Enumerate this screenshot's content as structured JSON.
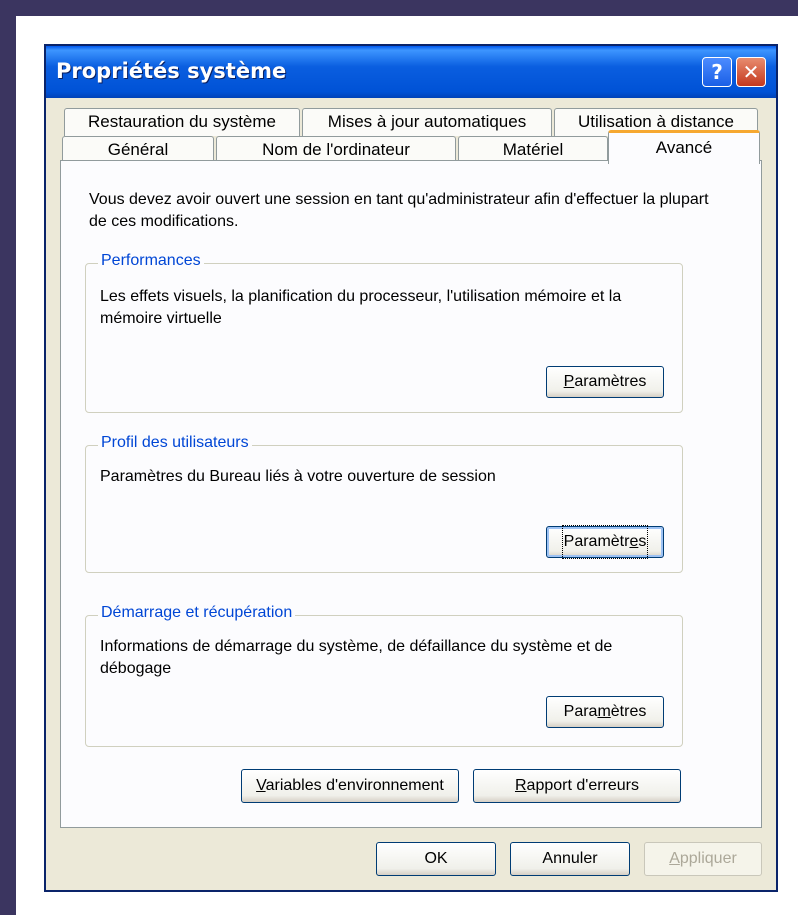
{
  "window": {
    "title": "Propriétés système",
    "help_label": "?",
    "close_label": "✕"
  },
  "tabs": {
    "row1": [
      "Restauration du système",
      "Mises à jour automatiques",
      "Utilisation à distance"
    ],
    "row2": [
      "Général",
      "Nom de l'ordinateur",
      "Matériel",
      "Avancé"
    ],
    "active": "Avancé"
  },
  "intro_text": "Vous devez avoir ouvert une session en tant qu'administrateur afin d'effectuer la plupart de ces modifications.",
  "groups": {
    "performance": {
      "title": "Performances",
      "desc": "Les effets visuels, la planification du processeur, l'utilisation mémoire et la mémoire virtuelle",
      "button": "Paramètres",
      "button_mnemonic_index": 0
    },
    "user_profiles": {
      "title": "Profil des utilisateurs",
      "desc": "Paramètres du Bureau liés à votre ouverture de session",
      "button": "Paramètres",
      "button_mnemonic_index": 8
    },
    "startup_recovery": {
      "title": "Démarrage et récupération",
      "desc": "Informations de démarrage du système, de défaillance du système et de débogage",
      "button": "Paramètres",
      "button_mnemonic_index": 4
    }
  },
  "env_button": "Variables d'environnement",
  "error_report_button": "Rapport d'erreurs",
  "footer": {
    "ok": "OK",
    "cancel": "Annuler",
    "apply": "Appliquer"
  },
  "colors": {
    "frame": "#3b3560",
    "titlebar": "#0a5ee0",
    "group_title": "#0046d5",
    "arrow": "#e01010",
    "active_tab_accent": "#f6a830"
  },
  "icons": {
    "help": "question-mark-icon",
    "close": "close-x-icon",
    "annotation": "red-arrow-icon"
  }
}
